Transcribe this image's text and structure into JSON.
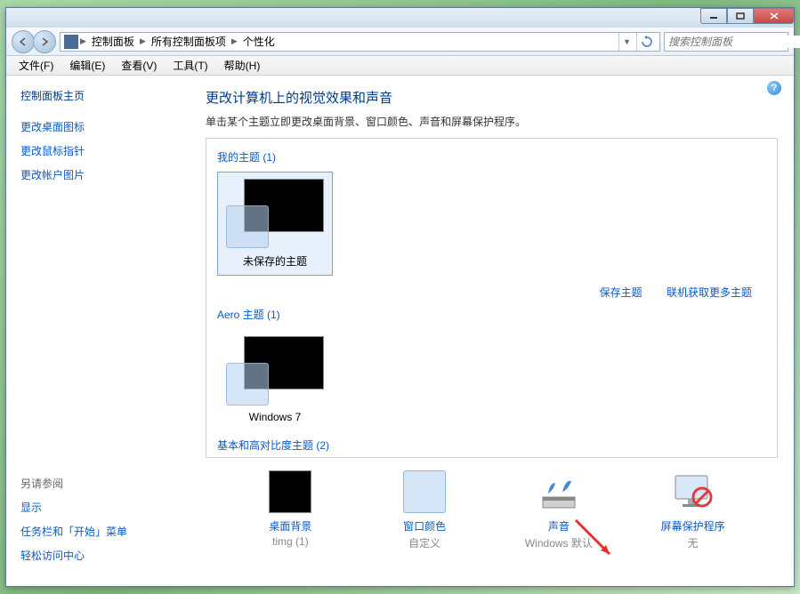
{
  "breadcrumb": [
    "控制面板",
    "所有控制面板项",
    "个性化"
  ],
  "search_placeholder": "搜索控制面板",
  "menu": {
    "file": "文件(F)",
    "edit": "编辑(E)",
    "view": "查看(V)",
    "tools": "工具(T)",
    "help": "帮助(H)"
  },
  "sidebar": {
    "home": "控制面板主页",
    "links": [
      "更改桌面图标",
      "更改鼠标指针",
      "更改帐户图片"
    ],
    "see_also": "另请参阅",
    "foot": [
      "显示",
      "任务栏和「开始」菜单",
      "轻松访问中心"
    ]
  },
  "main": {
    "title": "更改计算机上的视觉效果和声音",
    "subtitle": "单击某个主题立即更改桌面背景、窗口颜色、声音和屏幕保护程序。",
    "cat_my": "我的主题 (1)",
    "theme_unsaved": "未保存的主题",
    "link_save": "保存主题",
    "link_more": "联机获取更多主题",
    "cat_aero": "Aero 主题 (1)",
    "theme_win7": "Windows 7",
    "cat_basic": "基本和高对比度主题 (2)"
  },
  "bottom": {
    "bg_label": "桌面背景",
    "bg_val": "timg (1)",
    "color_label": "窗口颜色",
    "color_val": "自定义",
    "sound_label": "声音",
    "sound_val": "Windows 默认",
    "ss_label": "屏幕保护程序",
    "ss_val": "无"
  }
}
